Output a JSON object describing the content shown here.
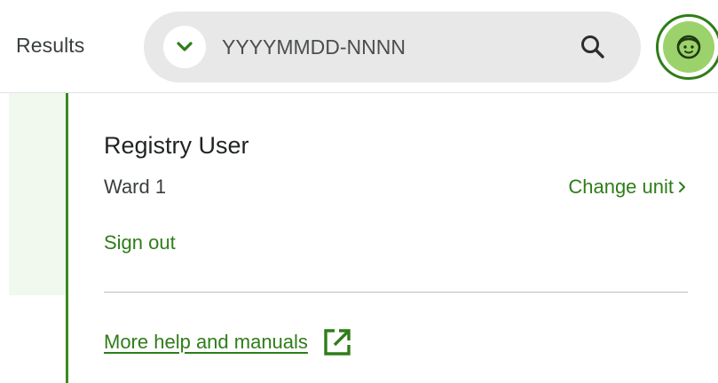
{
  "header": {
    "nav_results": "Results",
    "search": {
      "placeholder": "YYYYMMDD-NNNN",
      "type_icon": "chevron-down-icon",
      "search_icon": "search-icon"
    },
    "avatar_icon": "smiley-face-icon"
  },
  "user_menu": {
    "user_name": "Registry User",
    "unit": "Ward 1",
    "change_unit_label": "Change unit",
    "sign_out_label": "Sign out",
    "help_label": "More help and manuals",
    "help_icon": "external-link-icon"
  },
  "colors": {
    "accent": "#2f7d19",
    "avatar_fill": "#9bd26b",
    "search_bg": "#e8e8e8",
    "panel_bg_strip": "#f1f8ee"
  }
}
